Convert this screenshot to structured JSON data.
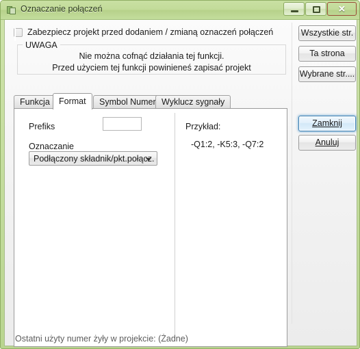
{
  "window": {
    "title": "Oznaczanie połączeń",
    "icon": "overlapping-squares-icon",
    "controls": {
      "minimize": "minimize-icon",
      "maximize": "maximize-icon",
      "close": "✕"
    },
    "titlebar_color": "#c3dc9c",
    "frame_color": "#8fae63"
  },
  "protect": {
    "label": "Zabezpiecz projekt przed dodaniem / zmianą oznaczeń połączeń",
    "checked": false
  },
  "warning_group": {
    "legend": "UWAGA",
    "line1": "Nie można cofnąć działania tej funkcji.",
    "line2": "Przed użyciem tej funkcji powinieneś zapisać projekt"
  },
  "tabs": [
    {
      "label": "Funkcja",
      "active": false
    },
    {
      "label": "Format",
      "active": true
    },
    {
      "label": "Symbol Numeru",
      "active": false
    },
    {
      "label": "Wyklucz sygnały",
      "active": false
    }
  ],
  "format_tab": {
    "prefix_label": "Prefiks",
    "prefix_value": "",
    "prefix_placeholder": "",
    "marking_label": "Oznaczanie",
    "marking_selected": "Podłączony składnik/pkt.połącz.",
    "example_label": "Przykład:",
    "example_value": "-Q1:2, -K5:3, -Q7:2"
  },
  "side_buttons": {
    "all_pages": "Wszystkie str.",
    "this_page": "Ta strona",
    "selected_pages": "Wybrane str....",
    "close": "Zamknij",
    "cancel": "Anuluj",
    "default_button": "Zamknij",
    "focus_color": "#3c7fb1"
  },
  "statusbar": {
    "text": "Ostatni użyty numer żyły w projekcie: (Żadne)"
  }
}
